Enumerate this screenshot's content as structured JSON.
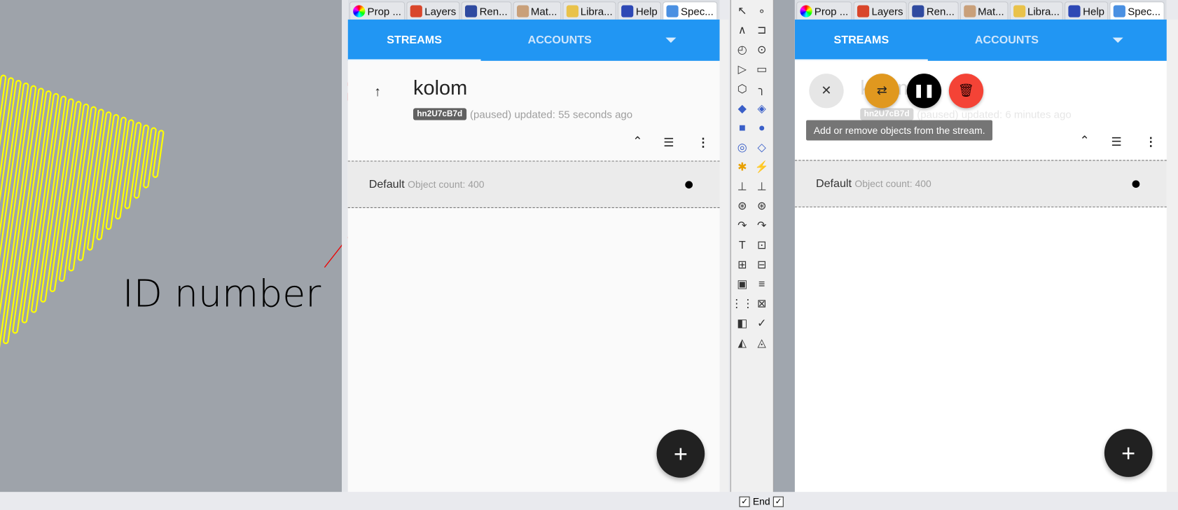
{
  "annotation": {
    "label": "ID number",
    "color": "#ff0000"
  },
  "dock_tabs": [
    {
      "label": "Prop ...",
      "icon": "color-wheel-icon"
    },
    {
      "label": "Layers",
      "icon": "layers-icon"
    },
    {
      "label": "Ren...",
      "icon": "render-icon"
    },
    {
      "label": "Mat...",
      "icon": "material-icon"
    },
    {
      "label": "Libra...",
      "icon": "folder-icon"
    },
    {
      "label": "Help",
      "icon": "help-icon"
    },
    {
      "label": "Spec...",
      "icon": "speckle-icon"
    }
  ],
  "left_panel": {
    "tabs": {
      "streams": "STREAMS",
      "accounts": "ACCOUNTS"
    },
    "stream": {
      "name": "kolom",
      "id": "hn2U7cB7d",
      "status": "(paused) updated: 55 seconds ago"
    },
    "layer": {
      "name": "Default",
      "count": "Object count: 400"
    },
    "fab": "+"
  },
  "right_panel": {
    "tabs": {
      "streams": "STREAMS",
      "accounts": "ACCOUNTS"
    },
    "stream": {
      "name": "kolom",
      "id": "hn2U7cB7d",
      "status": "(paused) updated: 6 minutes ago"
    },
    "tooltip": "Add or remove objects from the stream.",
    "layer": {
      "name": "Default",
      "count": "Object count: 400"
    },
    "fab": "+"
  },
  "bottom": {
    "end_label": "End"
  },
  "colors": {
    "accent": "#2196f3",
    "orange": "#e0981f",
    "red": "#f44336",
    "viewport_bg": "#9ea3aa",
    "geometry": "#ffff00"
  }
}
